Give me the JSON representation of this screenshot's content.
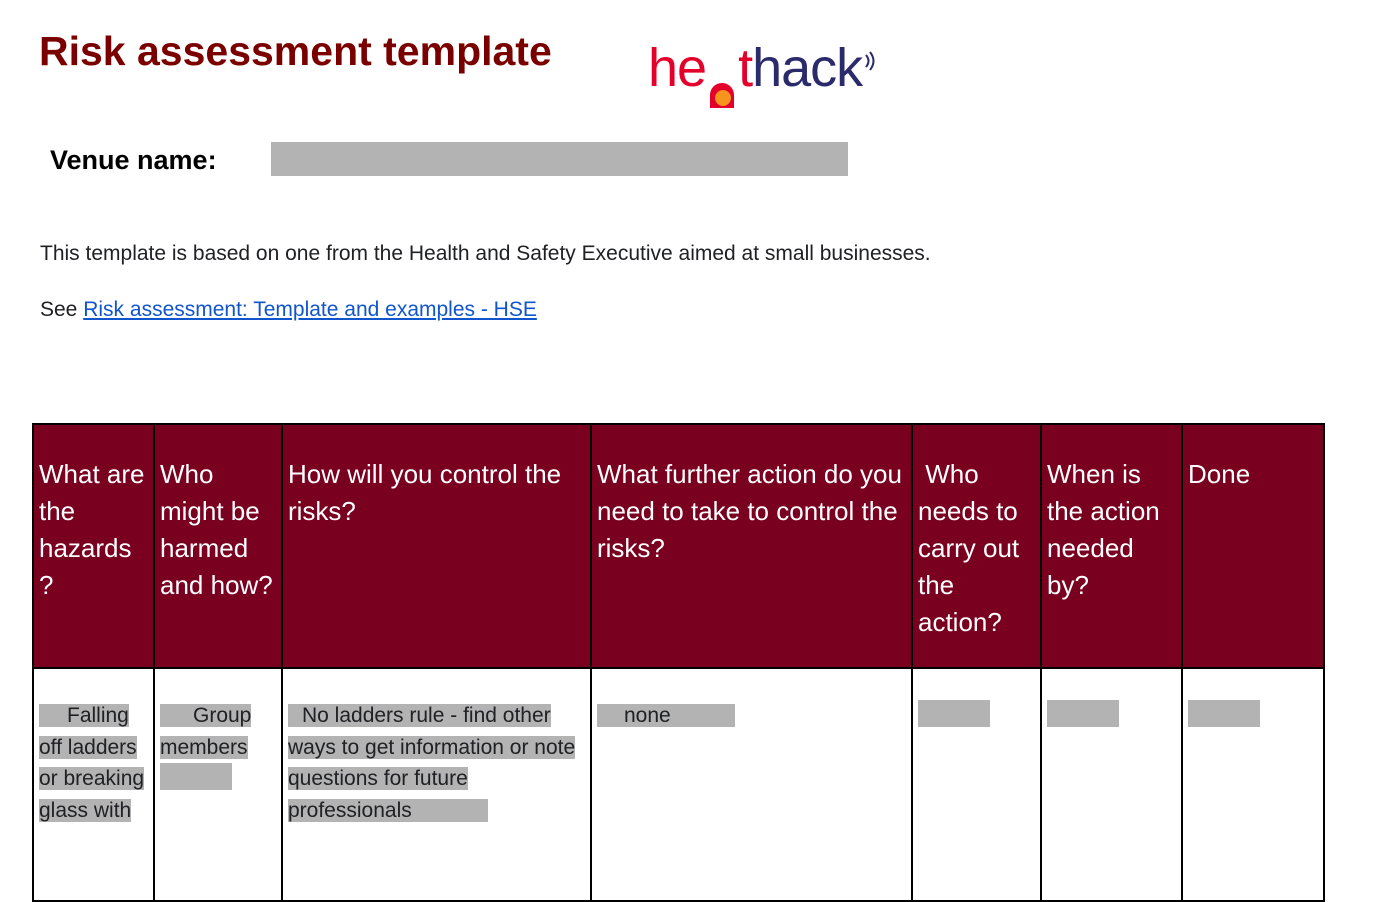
{
  "title": "Risk assessment template",
  "logo": {
    "part1": "he",
    "part2": "t",
    "part3": "hack"
  },
  "venue": {
    "label": "Venue name:",
    "value": ""
  },
  "intro": "This template is based on one from the Health and Safety Executive aimed at small businesses.",
  "see_prefix": "See",
  "see_link": "Risk assessment: Template and examples - HSE",
  "colors": {
    "title": "#7a0000",
    "header_bg": "#7a0020",
    "highlight": "#b3b3b3",
    "link": "#1155cc",
    "logo_red": "#e4002b",
    "logo_orange": "#f7941d",
    "logo_navy": "#2b2a6b"
  },
  "table": {
    "headers": [
      "What are the hazards ?",
      "Who might be harmed and how?",
      "How will you control the risks?",
      "What further action do you need to take to control the risks?",
      " Who needs to carry out the action?",
      "When is the action needed by?",
      "Done"
    ],
    "rows": [
      {
        "hazard": "Falling off ladders or breaking glass with",
        "who": "Group members",
        "control": "No ladders rule - find other ways to get information or note questions for future professionals",
        "further": "none",
        "who_action": "",
        "when": "",
        "done": ""
      }
    ]
  }
}
